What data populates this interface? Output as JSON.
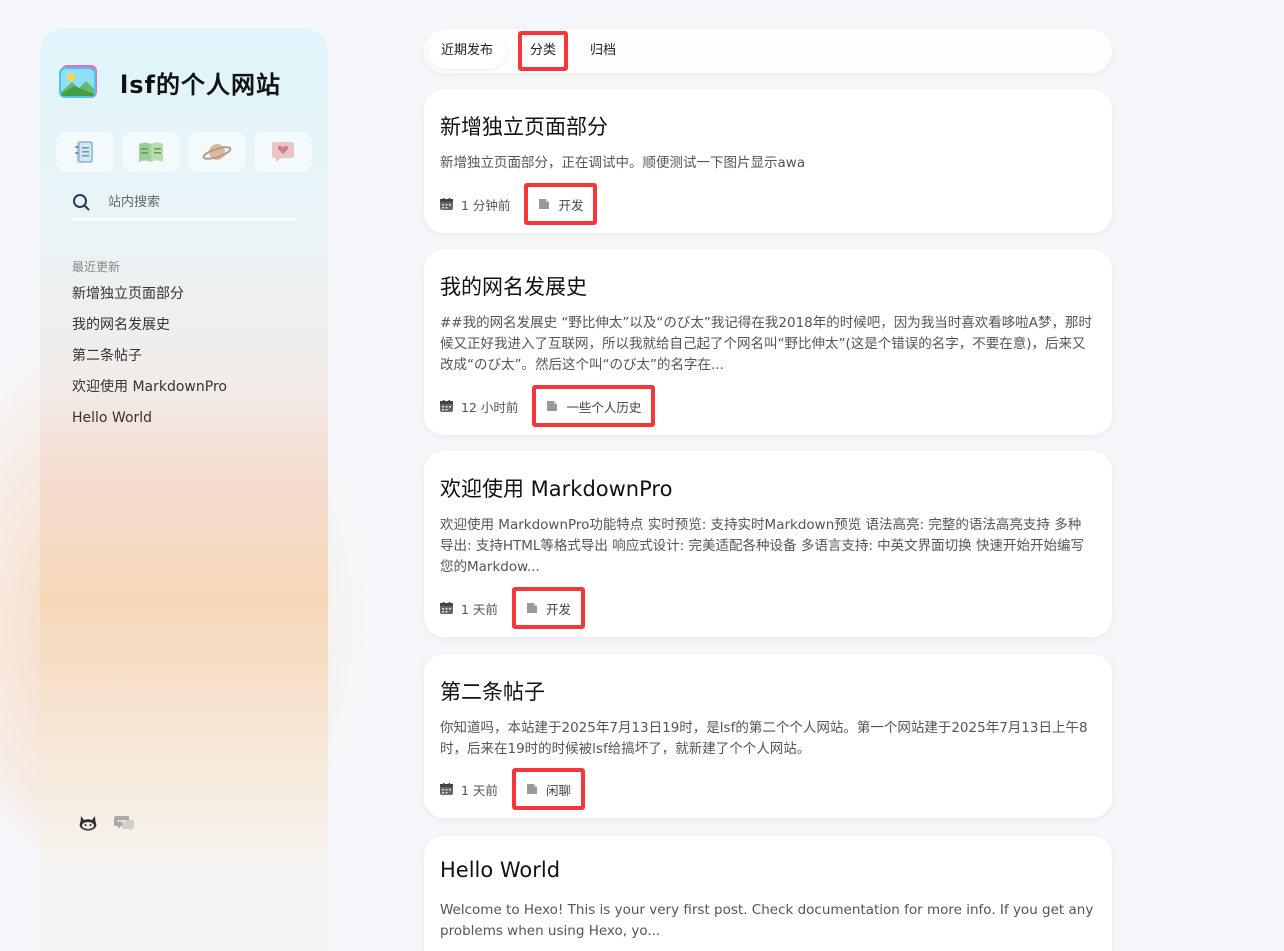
{
  "site": {
    "title": "lsf的个人网站"
  },
  "quick_links": [
    {
      "icon": "notebook-icon"
    },
    {
      "icon": "open-book-icon"
    },
    {
      "icon": "planet-icon"
    },
    {
      "icon": "heart-message-icon"
    }
  ],
  "search": {
    "placeholder": "站内搜索",
    "value": ""
  },
  "recent": {
    "label": "最近更新",
    "items": [
      "新增独立页面部分",
      "我的网名发展史",
      "第二条帖子",
      "欢迎使用 MarkdownPro",
      "Hello World"
    ]
  },
  "socials": [
    {
      "icon": "github-icon"
    },
    {
      "icon": "chat-icon"
    }
  ],
  "tabs": [
    {
      "label": "近期发布",
      "active": true
    },
    {
      "label": "分类",
      "highlighted": true
    },
    {
      "label": "归档"
    }
  ],
  "posts": [
    {
      "title": "新增独立页面部分",
      "excerpt": "新增独立页面部分，正在调试中。顺便测试一下图片显示awa",
      "time": "1 分钟前",
      "category": "开发"
    },
    {
      "title": "我的网名发展史",
      "excerpt": "##我的网名发展史 “野比伸太”以及“のび太”我记得在我2018年的时候吧，因为我当时喜欢看哆啦A梦，那时候又正好我进入了互联网，所以我就给自己起了个网名叫“野比伸太”(这是个错误的名字，不要在意)，后来又改成“のび太”。然后这个叫“のび太”的名字在...",
      "time": "12 小时前",
      "category": "一些个人历史"
    },
    {
      "title": "欢迎使用 MarkdownPro",
      "excerpt": "欢迎使用 MarkdownPro功能特点 实时预览: 支持实时Markdown预览 语法高亮: 完整的语法高亮支持 多种导出: 支持HTML等格式导出 响应式设计: 完美适配各种设备 多语言支持: 中英文界面切换 快速开始开始编写您的Markdow...",
      "time": "1 天前",
      "category": "开发"
    },
    {
      "title": "第二条帖子",
      "excerpt": "你知道吗，本站建于2025年7月13日19时，是lsf的第二个个人网站。第一个网站建于2025年7月13日上午8时，后来在19时的时候被lsf给搞坏了，就新建了个个人网站。",
      "time": "1 天前",
      "category": "闲聊"
    },
    {
      "title": "Hello World",
      "excerpt": "Welcome to Hexo! This is your very first post. Check documentation for more info. If you get any problems when using Hexo, yo..."
    }
  ],
  "colors": {
    "highlight_border": "#f4373b",
    "background": "#f6f7fa",
    "card": "#ffffff"
  }
}
